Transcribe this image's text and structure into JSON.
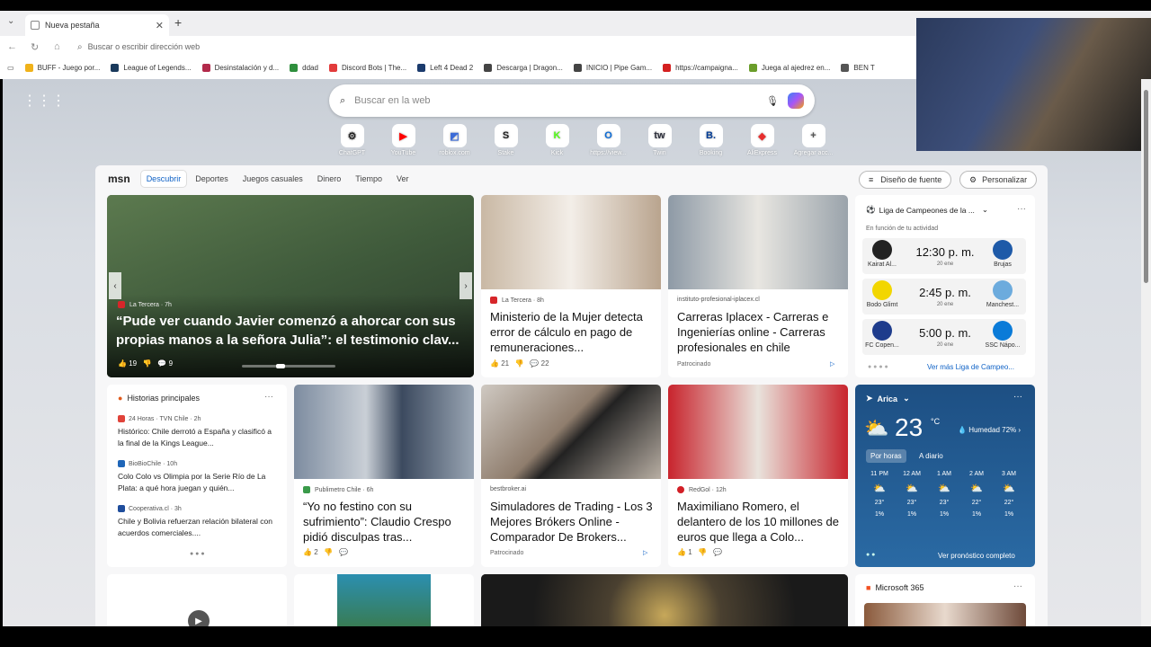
{
  "browser": {
    "tab_title": "Nueva pestaña",
    "address_placeholder": "Buscar o escribir dirección web",
    "bookmarks": [
      {
        "label": "BUFF - Juego por...",
        "color": "#f0b21a"
      },
      {
        "label": "League of Legends...",
        "color": "#1a3a5c"
      },
      {
        "label": "Desinstalación y d...",
        "color": "#b22a4b"
      },
      {
        "label": "ddad",
        "color": "#2f8f3d"
      },
      {
        "label": "Discord Bots | The...",
        "color": "#e23b3b"
      },
      {
        "label": "Left 4 Dead 2",
        "color": "#1b3b6d"
      },
      {
        "label": "Descarga | Dragon...",
        "color": "#444444"
      },
      {
        "label": "INICIO | Pipe Gam...",
        "color": "#444444"
      },
      {
        "label": "https://campaigna...",
        "color": "#d42020"
      },
      {
        "label": "Juega al ajedrez en...",
        "color": "#6a9d2a"
      },
      {
        "label": "BEN T",
        "color": "#555555"
      }
    ]
  },
  "newtab": {
    "search_placeholder": "Buscar en la web",
    "shortcuts": [
      {
        "label": "ChatGPT",
        "icon": "⚙",
        "color": "#222222"
      },
      {
        "label": "YouTube",
        "icon": "▶",
        "color": "#ff0000"
      },
      {
        "label": "roblox.com",
        "icon": "◩",
        "color": "#3b6bd8"
      },
      {
        "label": "Stake",
        "icon": "S",
        "color": "#1c1c1c"
      },
      {
        "label": "Kick",
        "icon": "K",
        "color": "#53fc18"
      },
      {
        "label": "https://view...",
        "icon": "O",
        "color": "#0a6ad6"
      },
      {
        "label": "Twin",
        "icon": "tw",
        "color": "#2b2d3a"
      },
      {
        "label": "Booking",
        "icon": "B.",
        "color": "#003b95"
      },
      {
        "label": "AliExpress",
        "icon": "◆",
        "color": "#e62e2e"
      },
      {
        "label": "Agregar acc...",
        "icon": "+",
        "color": "#555555"
      }
    ]
  },
  "msn": {
    "logo": "msn",
    "nav": [
      "Descubrir",
      "Deportes",
      "Juegos casuales",
      "Dinero",
      "Tiempo",
      "Ver"
    ],
    "font_button": "Diseño de fuente",
    "personalize_button": "Personalizar",
    "hero": {
      "source": "La Tercera · 7h",
      "title": "“Pude ver cuando Javier comenzó a ahorcar con sus propias manos a la señora Julia”: el testimonio clav...",
      "likes": "19",
      "comments": "9"
    },
    "card1": {
      "source": "La Tercera · 8h",
      "title": "Ministerio de la Mujer detecta error de cálculo en pago de remuneraciones...",
      "likes": "21",
      "comments": "22"
    },
    "card2": {
      "source": "instituto-profesional-iplacex.cl",
      "title": "Carreras Iplacex - Carreras e Ingenierías online - Carreras profesionales en chile",
      "ad": "Patrocinado"
    },
    "sports": {
      "title": "Liga de Campeones de la ...",
      "subtitle": "En función de tu actividad",
      "matches": [
        {
          "time": "12:30 p. m.",
          "date": "20 ene",
          "home": "Kairat Al...",
          "away": "Brujas",
          "home_color": "#222222",
          "away_color": "#1e5aa8"
        },
        {
          "time": "2:45 p. m.",
          "date": "20 ene",
          "home": "Bodo Glimt",
          "away": "Manchest...",
          "home_color": "#f2d600",
          "away_color": "#6cabdd"
        },
        {
          "time": "5:00 p. m.",
          "date": "20 ene",
          "home": "FC Copen...",
          "away": "SSC Nápo...",
          "home_color": "#1e3c8c",
          "away_color": "#0a7bd8"
        }
      ],
      "more": "Ver más Liga de Campeo..."
    },
    "top_stories": {
      "title": "Historias principales",
      "items": [
        {
          "source": "24 Horas · TVN Chile · 2h",
          "text": "Histórico: Chile derrotó a España y clasificó a la final de la Kings League...",
          "color": "#e0433a"
        },
        {
          "source": "BioBioChile · 10h",
          "text": "Colo Colo vs Olimpia por la Serie Río de La Plata: a qué hora juegan y quién...",
          "color": "#1f66b8"
        },
        {
          "source": "Cooperativa.cl · 3h",
          "text": "Chile y Bolivia refuerzan relación bilateral con acuerdos comerciales....",
          "color": "#1f4d9c"
        }
      ]
    },
    "card3": {
      "source": "Publimetro Chile · 6h",
      "title": "“Yo no festino con su sufrimiento”: Claudio Crespo pidió disculpas tras...",
      "likes": "2"
    },
    "card4": {
      "source": "bestbroker.ai",
      "title": "Simuladores de Trading - Los 3 Mejores Brókers Online - Comparador De Brokers...",
      "ad": "Patrocinado"
    },
    "card5": {
      "source": "RedGol · 12h",
      "title": "Maximiliano Romero, el delantero de los 10 millones de euros que llega a Colo...",
      "likes": "1"
    },
    "weather": {
      "location": "Arica",
      "temp": "23",
      "unit": "°C",
      "humidity": "Humedad 72%",
      "tab_hourly": "Por horas",
      "tab_daily": "A diario",
      "hours": [
        {
          "h": "11 PM",
          "t": "23°",
          "p": "1%"
        },
        {
          "h": "12 AM",
          "t": "23°",
          "p": "1%"
        },
        {
          "h": "1 AM",
          "t": "23°",
          "p": "1%"
        },
        {
          "h": "2 AM",
          "t": "22°",
          "p": "1%"
        },
        {
          "h": "3 AM",
          "t": "22°",
          "p": "1%"
        }
      ],
      "forecast_link": "Ver pronóstico completo"
    },
    "m365": {
      "title": "Microsoft 365"
    }
  }
}
